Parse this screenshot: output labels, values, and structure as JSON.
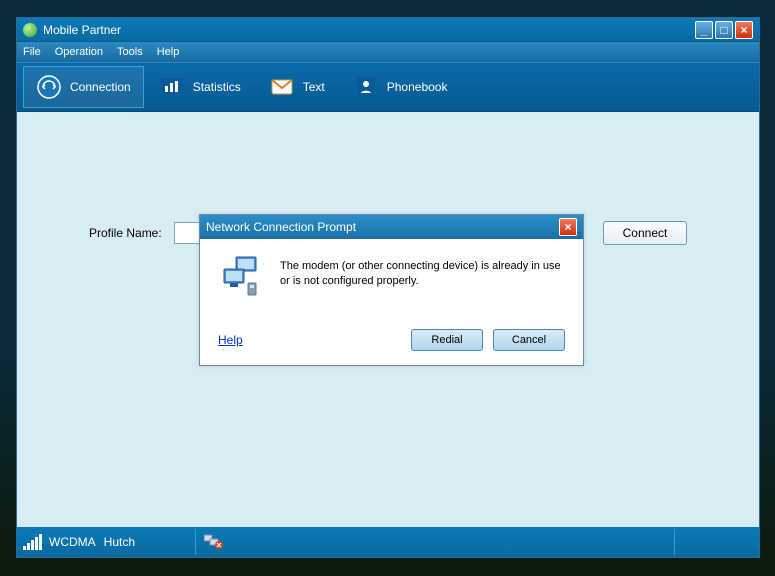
{
  "title": "Mobile Partner",
  "menu": {
    "file": "File",
    "operation": "Operation",
    "tools": "Tools",
    "help": "Help"
  },
  "toolbar": {
    "connection": "Connection",
    "statistics": "Statistics",
    "text": "Text",
    "phonebook": "Phonebook"
  },
  "main": {
    "profile_label": "Profile Name:",
    "connect_label": "Connect"
  },
  "dialog": {
    "title": "Network Connection Prompt",
    "message": "The modem (or other connecting device) is already in use or is not configured properly.",
    "help": "Help",
    "redial": "Redial",
    "cancel": "Cancel"
  },
  "status": {
    "network": "WCDMA",
    "operator": "Hutch"
  }
}
